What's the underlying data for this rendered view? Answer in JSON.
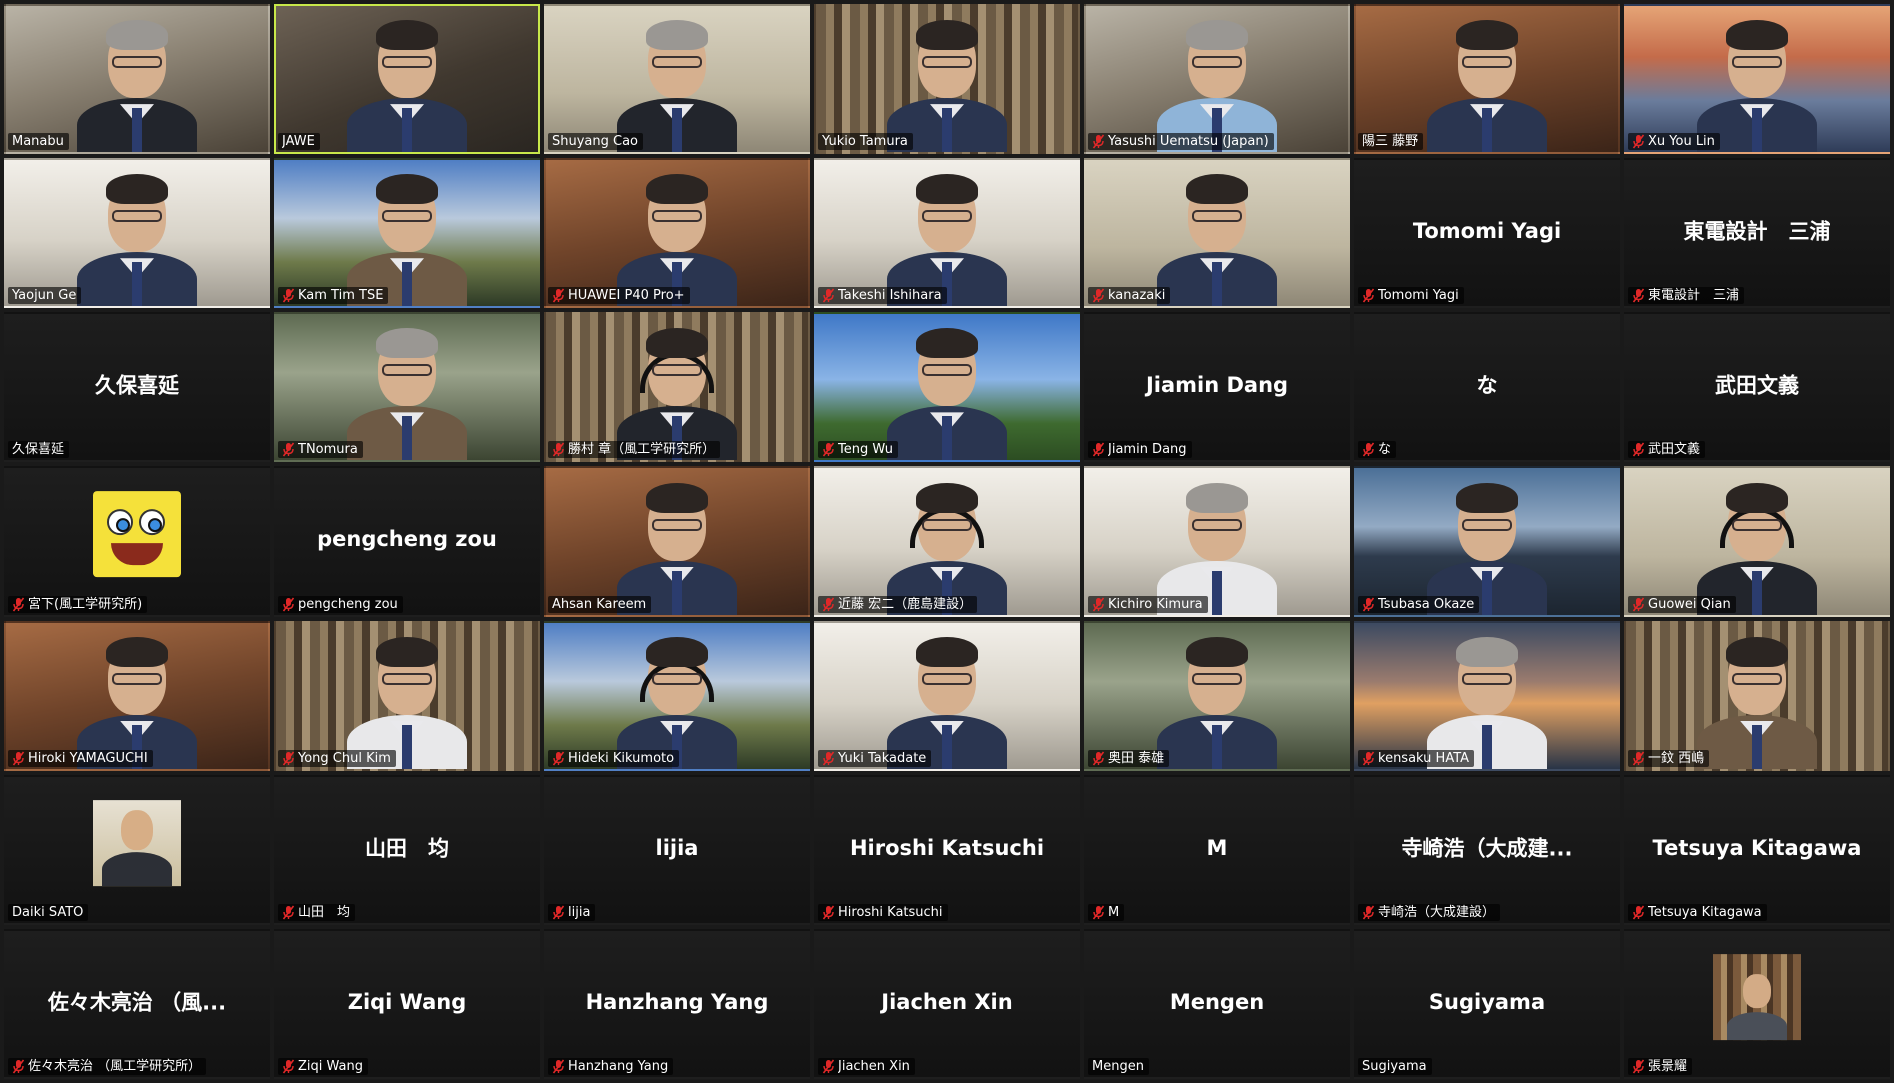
{
  "colors": {
    "active_speaker_border": "#c8e84a",
    "muted_icon": "#e02828",
    "tile_background": "#232323",
    "app_background": "#1a1a1a"
  },
  "participants": [
    {
      "name": "Manabu",
      "muted": false,
      "video": true
    },
    {
      "name": "JAWE",
      "muted": false,
      "video": true,
      "active_speaker": true
    },
    {
      "name": "Shuyang Cao",
      "muted": false,
      "video": true
    },
    {
      "name": "Yukio Tamura",
      "muted": false,
      "video": true
    },
    {
      "name": "Yasushi Uematsu (Japan)",
      "muted": true,
      "video": true
    },
    {
      "name": "陽三 藤野",
      "muted": false,
      "video": true
    },
    {
      "name": "Xu You Lin",
      "muted": true,
      "video": true
    },
    {
      "name": "Yaojun Ge",
      "muted": false,
      "video": true
    },
    {
      "name": "Kam Tim TSE",
      "muted": true,
      "video": true
    },
    {
      "name": "HUAWEI P40 Pro+",
      "muted": true,
      "video": true
    },
    {
      "name": "Takeshi Ishihara",
      "muted": true,
      "video": true
    },
    {
      "name": "kanazaki",
      "muted": true,
      "video": true
    },
    {
      "name": "Tomomi Yagi",
      "muted": true,
      "video": false,
      "display": "Tomomi Yagi"
    },
    {
      "name": "東電設計　三浦",
      "muted": true,
      "video": false,
      "display": "東電設計　三浦"
    },
    {
      "name": "久保喜延",
      "muted": false,
      "video": false,
      "display": "久保喜延"
    },
    {
      "name": "TNomura",
      "muted": true,
      "video": true
    },
    {
      "name": "勝村 章（風工学研究所）",
      "muted": true,
      "video": true
    },
    {
      "name": "Teng Wu",
      "muted": true,
      "video": true
    },
    {
      "name": "Jiamin Dang",
      "muted": true,
      "video": false,
      "display": "Jiamin Dang"
    },
    {
      "name": "な",
      "muted": true,
      "video": false,
      "display": "な"
    },
    {
      "name": "武田文義",
      "muted": true,
      "video": false,
      "display": "武田文義"
    },
    {
      "name": "宮下(風工学研究所)",
      "muted": true,
      "video": false,
      "avatar": "sponge"
    },
    {
      "name": "pengcheng zou",
      "muted": true,
      "video": false,
      "display": "pengcheng zou"
    },
    {
      "name": "Ahsan Kareem",
      "muted": false,
      "video": true
    },
    {
      "name": "近藤 宏二（鹿島建設）",
      "muted": true,
      "video": true
    },
    {
      "name": "Kichiro Kimura",
      "muted": true,
      "video": true
    },
    {
      "name": "Tsubasa Okaze",
      "muted": true,
      "video": true
    },
    {
      "name": "Guowei Qian",
      "muted": true,
      "video": true
    },
    {
      "name": "Hiroki YAMAGUCHI",
      "muted": true,
      "video": true
    },
    {
      "name": "Yong Chul Kim",
      "muted": true,
      "video": true
    },
    {
      "name": "Hideki Kikumoto",
      "muted": true,
      "video": true
    },
    {
      "name": "Yuki Takadate",
      "muted": true,
      "video": true
    },
    {
      "name": "奥田 泰雄",
      "muted": true,
      "video": true
    },
    {
      "name": "kensaku HATA",
      "muted": true,
      "video": true
    },
    {
      "name": "一鈫 西嶋",
      "muted": true,
      "video": true
    },
    {
      "name": "Daiki SATO",
      "muted": false,
      "video": false,
      "avatar": "photo"
    },
    {
      "name": "山田　均",
      "muted": true,
      "video": false,
      "display": "山田　均"
    },
    {
      "name": "lijia",
      "muted": true,
      "video": false,
      "display": "lijia"
    },
    {
      "name": "Hiroshi Katsuchi",
      "muted": true,
      "video": false,
      "display": "Hiroshi Katsuchi"
    },
    {
      "name": "M",
      "muted": true,
      "video": false,
      "display": "M"
    },
    {
      "name": "寺崎浩（大成建設）",
      "muted": true,
      "video": false,
      "display": "寺崎浩（大成建..."
    },
    {
      "name": "Tetsuya Kitagawa",
      "muted": true,
      "video": false,
      "display": "Tetsuya Kitagawa"
    },
    {
      "name": "佐々木亮治 （風工学研究所）",
      "muted": true,
      "video": false,
      "display": "佐々木亮治 （風..."
    },
    {
      "name": "Ziqi Wang",
      "muted": true,
      "video": false,
      "display": "Ziqi Wang"
    },
    {
      "name": "Hanzhang Yang",
      "muted": true,
      "video": false,
      "display": "Hanzhang Yang"
    },
    {
      "name": "Jiachen Xin",
      "muted": true,
      "video": false,
      "display": "Jiachen Xin"
    },
    {
      "name": "Mengen",
      "muted": false,
      "video": false,
      "display": "Mengen"
    },
    {
      "name": "Sugiyama",
      "muted": false,
      "video": false,
      "display": "Sugiyama"
    },
    {
      "name": "張景耀",
      "muted": true,
      "video": false,
      "avatar": "shelf"
    }
  ]
}
